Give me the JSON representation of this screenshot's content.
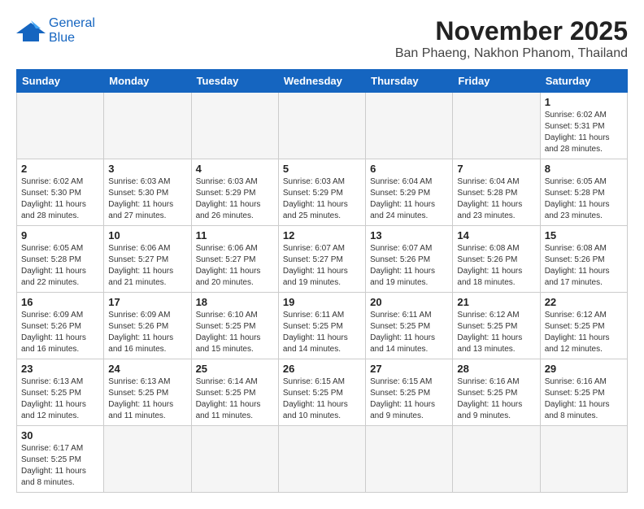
{
  "header": {
    "logo_line1": "General",
    "logo_line2": "Blue",
    "title": "November 2025",
    "subtitle": "Ban Phaeng, Nakhon Phanom, Thailand"
  },
  "weekdays": [
    "Sunday",
    "Monday",
    "Tuesday",
    "Wednesday",
    "Thursday",
    "Friday",
    "Saturday"
  ],
  "days": [
    {
      "day": "",
      "info": ""
    },
    {
      "day": "",
      "info": ""
    },
    {
      "day": "",
      "info": ""
    },
    {
      "day": "",
      "info": ""
    },
    {
      "day": "",
      "info": ""
    },
    {
      "day": "",
      "info": ""
    },
    {
      "day": "1",
      "info": "Sunrise: 6:02 AM\nSunset: 5:31 PM\nDaylight: 11 hours\nand 28 minutes."
    },
    {
      "day": "2",
      "info": "Sunrise: 6:02 AM\nSunset: 5:30 PM\nDaylight: 11 hours\nand 28 minutes."
    },
    {
      "day": "3",
      "info": "Sunrise: 6:03 AM\nSunset: 5:30 PM\nDaylight: 11 hours\nand 27 minutes."
    },
    {
      "day": "4",
      "info": "Sunrise: 6:03 AM\nSunset: 5:29 PM\nDaylight: 11 hours\nand 26 minutes."
    },
    {
      "day": "5",
      "info": "Sunrise: 6:03 AM\nSunset: 5:29 PM\nDaylight: 11 hours\nand 25 minutes."
    },
    {
      "day": "6",
      "info": "Sunrise: 6:04 AM\nSunset: 5:29 PM\nDaylight: 11 hours\nand 24 minutes."
    },
    {
      "day": "7",
      "info": "Sunrise: 6:04 AM\nSunset: 5:28 PM\nDaylight: 11 hours\nand 23 minutes."
    },
    {
      "day": "8",
      "info": "Sunrise: 6:05 AM\nSunset: 5:28 PM\nDaylight: 11 hours\nand 23 minutes."
    },
    {
      "day": "9",
      "info": "Sunrise: 6:05 AM\nSunset: 5:28 PM\nDaylight: 11 hours\nand 22 minutes."
    },
    {
      "day": "10",
      "info": "Sunrise: 6:06 AM\nSunset: 5:27 PM\nDaylight: 11 hours\nand 21 minutes."
    },
    {
      "day": "11",
      "info": "Sunrise: 6:06 AM\nSunset: 5:27 PM\nDaylight: 11 hours\nand 20 minutes."
    },
    {
      "day": "12",
      "info": "Sunrise: 6:07 AM\nSunset: 5:27 PM\nDaylight: 11 hours\nand 19 minutes."
    },
    {
      "day": "13",
      "info": "Sunrise: 6:07 AM\nSunset: 5:26 PM\nDaylight: 11 hours\nand 19 minutes."
    },
    {
      "day": "14",
      "info": "Sunrise: 6:08 AM\nSunset: 5:26 PM\nDaylight: 11 hours\nand 18 minutes."
    },
    {
      "day": "15",
      "info": "Sunrise: 6:08 AM\nSunset: 5:26 PM\nDaylight: 11 hours\nand 17 minutes."
    },
    {
      "day": "16",
      "info": "Sunrise: 6:09 AM\nSunset: 5:26 PM\nDaylight: 11 hours\nand 16 minutes."
    },
    {
      "day": "17",
      "info": "Sunrise: 6:09 AM\nSunset: 5:26 PM\nDaylight: 11 hours\nand 16 minutes."
    },
    {
      "day": "18",
      "info": "Sunrise: 6:10 AM\nSunset: 5:25 PM\nDaylight: 11 hours\nand 15 minutes."
    },
    {
      "day": "19",
      "info": "Sunrise: 6:11 AM\nSunset: 5:25 PM\nDaylight: 11 hours\nand 14 minutes."
    },
    {
      "day": "20",
      "info": "Sunrise: 6:11 AM\nSunset: 5:25 PM\nDaylight: 11 hours\nand 14 minutes."
    },
    {
      "day": "21",
      "info": "Sunrise: 6:12 AM\nSunset: 5:25 PM\nDaylight: 11 hours\nand 13 minutes."
    },
    {
      "day": "22",
      "info": "Sunrise: 6:12 AM\nSunset: 5:25 PM\nDaylight: 11 hours\nand 12 minutes."
    },
    {
      "day": "23",
      "info": "Sunrise: 6:13 AM\nSunset: 5:25 PM\nDaylight: 11 hours\nand 12 minutes."
    },
    {
      "day": "24",
      "info": "Sunrise: 6:13 AM\nSunset: 5:25 PM\nDaylight: 11 hours\nand 11 minutes."
    },
    {
      "day": "25",
      "info": "Sunrise: 6:14 AM\nSunset: 5:25 PM\nDaylight: 11 hours\nand 11 minutes."
    },
    {
      "day": "26",
      "info": "Sunrise: 6:15 AM\nSunset: 5:25 PM\nDaylight: 11 hours\nand 10 minutes."
    },
    {
      "day": "27",
      "info": "Sunrise: 6:15 AM\nSunset: 5:25 PM\nDaylight: 11 hours\nand 9 minutes."
    },
    {
      "day": "28",
      "info": "Sunrise: 6:16 AM\nSunset: 5:25 PM\nDaylight: 11 hours\nand 9 minutes."
    },
    {
      "day": "29",
      "info": "Sunrise: 6:16 AM\nSunset: 5:25 PM\nDaylight: 11 hours\nand 8 minutes."
    },
    {
      "day": "30",
      "info": "Sunrise: 6:17 AM\nSunset: 5:25 PM\nDaylight: 11 hours\nand 8 minutes."
    },
    {
      "day": "",
      "info": ""
    },
    {
      "day": "",
      "info": ""
    },
    {
      "day": "",
      "info": ""
    },
    {
      "day": "",
      "info": ""
    },
    {
      "day": "",
      "info": ""
    },
    {
      "day": "",
      "info": ""
    }
  ]
}
